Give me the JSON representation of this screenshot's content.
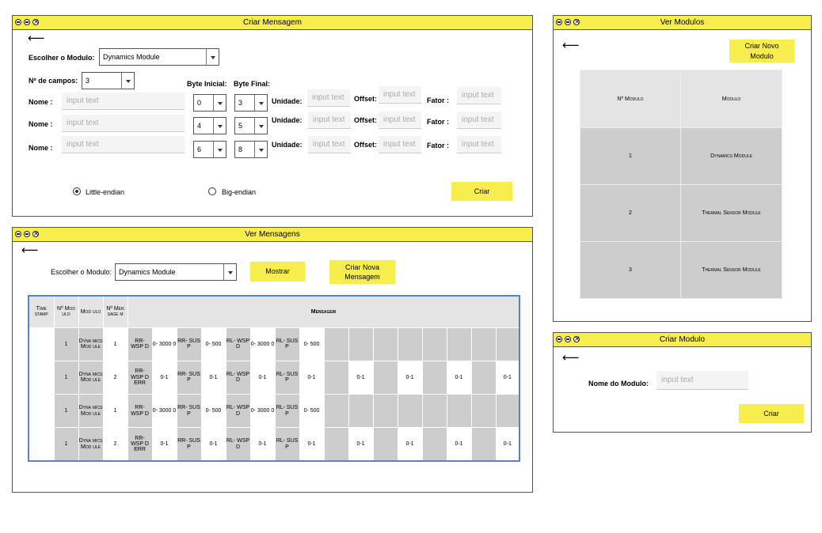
{
  "criar_mensagem": {
    "title": "Criar Mensagem",
    "back": "⟵",
    "modulo_label": "Escolher o Modulo:",
    "modulo_value": "Dynamics Module",
    "campos_label": "Nº de campos:",
    "campos_value": "3",
    "byte_inicial_label": "Byte Inicial:",
    "byte_final_label": "Byte Final:",
    "nome_label": "Nome :",
    "unidade_label": "Unidade:",
    "offset_label": "Offset:",
    "fator_label": "Fator :",
    "placeholder": "input text",
    "rows": [
      {
        "byte_inicial": "0",
        "byte_final": "3"
      },
      {
        "byte_inicial": "4",
        "byte_final": "5"
      },
      {
        "byte_inicial": "6",
        "byte_final": "8"
      }
    ],
    "little_endian": "Little-endian",
    "big_endian": "Big-endian",
    "criar": "Criar"
  },
  "ver_modulos": {
    "title": "Ver Modulos",
    "back": "⟵",
    "criar_novo": "Criar Novo Modulo",
    "headers": [
      "Nº Modulo",
      "Modulo"
    ],
    "rows": [
      {
        "num": "1",
        "name": "Dynamics Module"
      },
      {
        "num": "2",
        "name": "Thermal Sensor Module"
      },
      {
        "num": "3",
        "name": "Thermal Sensor Module"
      }
    ]
  },
  "ver_mensagens": {
    "title": "Ver Mensagens",
    "back": "⟵",
    "modulo_label": "Escolher o Modulo:",
    "modulo_value": "Dynamics Module",
    "mostrar": "Mostrar",
    "criar_nova": "Criar Nova Mensagem",
    "headers": [
      "Time stamp",
      "Nº Mod ulo",
      "Mod ulo",
      "Nº Men sage m",
      "Mensagem"
    ],
    "rows": [
      {
        "num": "1",
        "modulo": "Dyna mics Mod ule",
        "nmsg": "1",
        "cells": [
          "RR- WSP D",
          "0- 3000 0",
          "RR- SUS P",
          "0- 500",
          "RL- WSP D",
          "0- 3000 0",
          "RL- SUS P",
          "0- 500",
          "",
          "",
          "",
          "",
          "",
          "",
          "",
          ""
        ]
      },
      {
        "num": "1",
        "modulo": "Dyna mics Mod ule",
        "nmsg": "2",
        "cells": [
          "RR- WSP D ERR",
          "0-1",
          "RR- SUS P",
          "0-1",
          "RL- WSP D",
          "0-1",
          "RL- SUS P",
          "0-1",
          "",
          "0-1",
          "",
          "0-1",
          "",
          "0-1",
          "",
          "0-1"
        ]
      },
      {
        "num": "1",
        "modulo": "Dyna mics Mod ule",
        "nmsg": "1",
        "cells": [
          "RR- WSP D",
          "0- 3000 0",
          "RR- SUS P",
          "0- 500",
          "RL- WSP D",
          "0- 3000 0",
          "RL- SUS P",
          "0- 500",
          "",
          "",
          "",
          "",
          "",
          "",
          "",
          ""
        ]
      },
      {
        "num": "1",
        "modulo": "Dyna mics Mod ule",
        "nmsg": "2",
        "cells": [
          "RR- WSP D ERR",
          "0-1",
          "RR- SUS P",
          "0-1",
          "RL- WSP D",
          "0-1",
          "RL- SUS P",
          "0-1",
          "",
          "0-1",
          "",
          "0-1",
          "",
          "0-1",
          "",
          "0-1"
        ]
      }
    ]
  },
  "criar_modulo": {
    "title": "Criar Modulo",
    "back": "⟵",
    "nome_label": "Nome do Modulo:",
    "placeholder": "input text",
    "criar": "Criar"
  }
}
